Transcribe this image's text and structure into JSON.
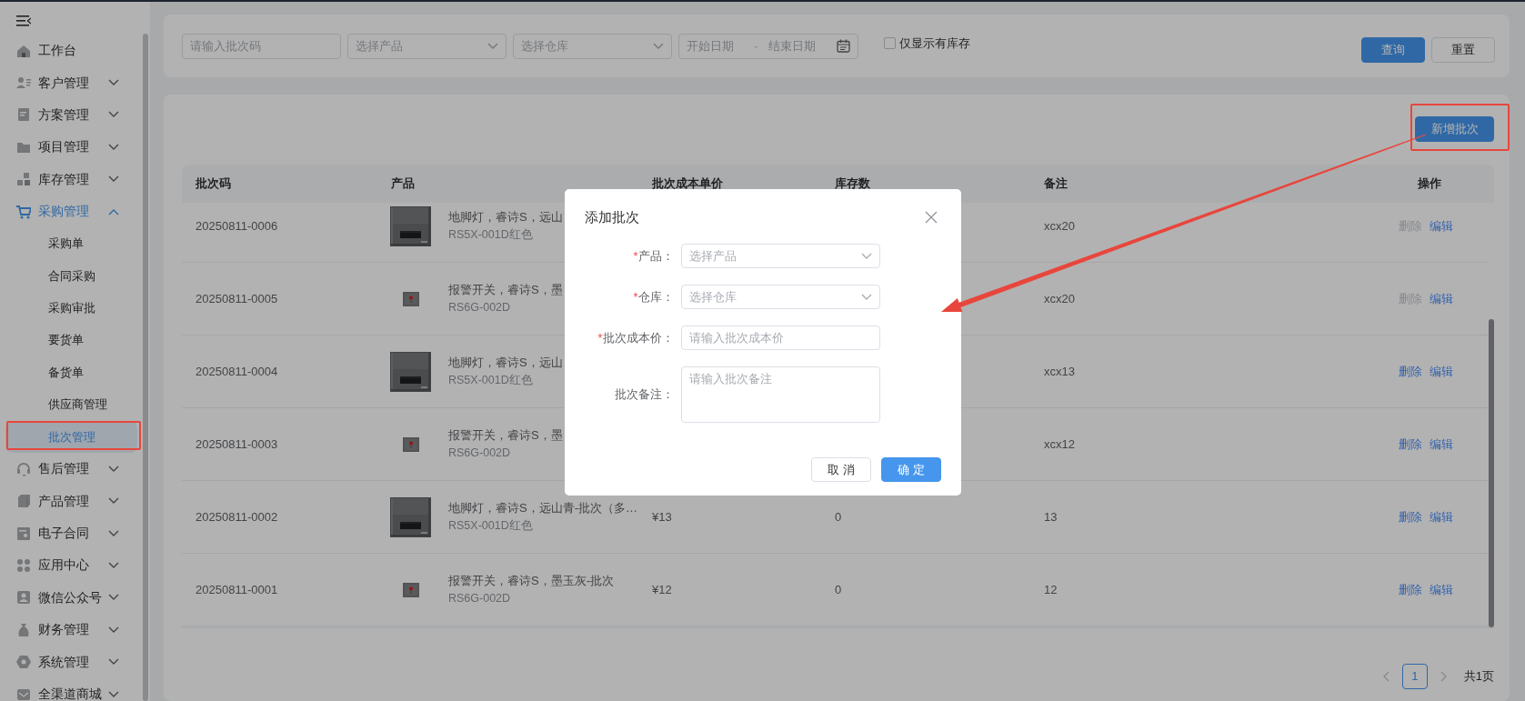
{
  "sidebar": {
    "items": [
      {
        "label": "工作台",
        "kind": "link"
      },
      {
        "label": "客户管理",
        "kind": "group",
        "expanded": false
      },
      {
        "label": "方案管理",
        "kind": "group",
        "expanded": false
      },
      {
        "label": "项目管理",
        "kind": "group",
        "expanded": false
      },
      {
        "label": "库存管理",
        "kind": "group",
        "expanded": false
      },
      {
        "label": "采购管理",
        "kind": "group",
        "expanded": true,
        "children": [
          {
            "label": "采购单",
            "selected": false,
            "highlighted": false
          },
          {
            "label": "合同采购",
            "selected": false,
            "highlighted": false
          },
          {
            "label": "采购审批",
            "selected": false,
            "highlighted": false
          },
          {
            "label": "要货单",
            "selected": false,
            "highlighted": false
          },
          {
            "label": "备货单",
            "selected": false,
            "highlighted": false
          },
          {
            "label": "供应商管理",
            "selected": false,
            "highlighted": false
          },
          {
            "label": "批次管理",
            "selected": true,
            "highlighted": true
          }
        ]
      },
      {
        "label": "售后管理",
        "kind": "group",
        "expanded": false
      },
      {
        "label": "产品管理",
        "kind": "group",
        "expanded": false
      },
      {
        "label": "电子合同",
        "kind": "group",
        "expanded": false
      },
      {
        "label": "应用中心",
        "kind": "group",
        "expanded": false
      },
      {
        "label": "微信公众号",
        "kind": "group",
        "expanded": false
      },
      {
        "label": "财务管理",
        "kind": "group",
        "expanded": false
      },
      {
        "label": "系统管理",
        "kind": "group",
        "expanded": false
      },
      {
        "label": "全渠道商城",
        "kind": "group",
        "expanded": false
      }
    ]
  },
  "filter": {
    "fields": [
      {
        "kind": "input",
        "placeholder": "请输入批次码"
      },
      {
        "kind": "select",
        "placeholder": "选择产品"
      },
      {
        "kind": "select",
        "placeholder": "选择仓库"
      },
      {
        "kind": "date_range",
        "placeholder": "开始日期",
        "separator": "-",
        "end_placeholder": "结束日期"
      }
    ],
    "checkbox": {
      "label": "仅显示有库存",
      "checked": false
    },
    "buttons": [
      {
        "label": "查询",
        "kind": "primary"
      },
      {
        "label": "重置",
        "kind": "default"
      }
    ]
  },
  "toolbar": {
    "add_button": {
      "label": "新增批次",
      "highlighted": true
    }
  },
  "table": {
    "columns": [
      "批次码",
      "产品",
      "批次成本单价",
      "库存数",
      "备注",
      "操作"
    ],
    "rows": [
      {
        "batch_code": "20250811-0006",
        "kind": "light",
        "product_name": "地脚灯，睿诗S，远山",
        "product_code": "RS5X-001D红色",
        "remark": "xcx20",
        "actions": [
          {
            "label": "删除",
            "disabled": true
          },
          {
            "label": "编辑",
            "disabled": false
          }
        ]
      },
      {
        "batch_code": "20250811-0005",
        "kind": "switch",
        "product_name": "报警开关，睿诗S，墨",
        "product_code": "RS6G-002D",
        "remark": "xcx20",
        "actions": [
          {
            "label": "删除",
            "disabled": true
          },
          {
            "label": "编辑",
            "disabled": false
          }
        ]
      },
      {
        "batch_code": "20250811-0004",
        "kind": "light",
        "product_name": "地脚灯，睿诗S，远山",
        "product_code": "RS5X-001D红色",
        "remark": "xcx13",
        "actions": [
          {
            "label": "删除",
            "disabled": false
          },
          {
            "label": "编辑",
            "disabled": false
          }
        ]
      },
      {
        "batch_code": "20250811-0003",
        "kind": "switch",
        "product_name": "报警开关，睿诗S，墨",
        "product_code": "RS6G-002D",
        "remark": "xcx12",
        "actions": [
          {
            "label": "删除",
            "disabled": false
          },
          {
            "label": "编辑",
            "disabled": false
          }
        ]
      },
      {
        "batch_code": "20250811-0002",
        "kind": "light",
        "product_name": "地脚灯，睿诗S，远山青-批次（多…",
        "product_code": "RS5X-001D红色",
        "cost": "¥13",
        "stock": "0",
        "remark": "13",
        "actions": [
          {
            "label": "删除",
            "disabled": false
          },
          {
            "label": "编辑",
            "disabled": false
          }
        ]
      },
      {
        "batch_code": "20250811-0001",
        "kind": "switch",
        "product_name": "报警开关，睿诗S，墨玉灰-批次",
        "product_code": "RS6G-002D",
        "cost": "¥12",
        "stock": "0",
        "remark": "12",
        "actions": [
          {
            "label": "删除",
            "disabled": false
          },
          {
            "label": "编辑",
            "disabled": false
          }
        ]
      }
    ]
  },
  "pagination": {
    "pages": [
      {
        "label": "1",
        "selected": true
      }
    ],
    "total": "共1页"
  },
  "dialog": {
    "title": "添加批次",
    "fields": [
      {
        "label": "产品：",
        "required": true,
        "kind": "select",
        "placeholder": "选择产品"
      },
      {
        "label": "仓库：",
        "required": true,
        "kind": "select",
        "placeholder": "选择仓库"
      },
      {
        "label": "批次成本价：",
        "required": true,
        "kind": "input",
        "placeholder": "请输入批次成本价"
      },
      {
        "label": "批次备注：",
        "required": false,
        "kind": "textarea",
        "placeholder": "请输入批次备注"
      }
    ],
    "buttons": [
      {
        "label": "取 消",
        "kind": "default"
      },
      {
        "label": "确 定",
        "kind": "primary"
      }
    ]
  }
}
